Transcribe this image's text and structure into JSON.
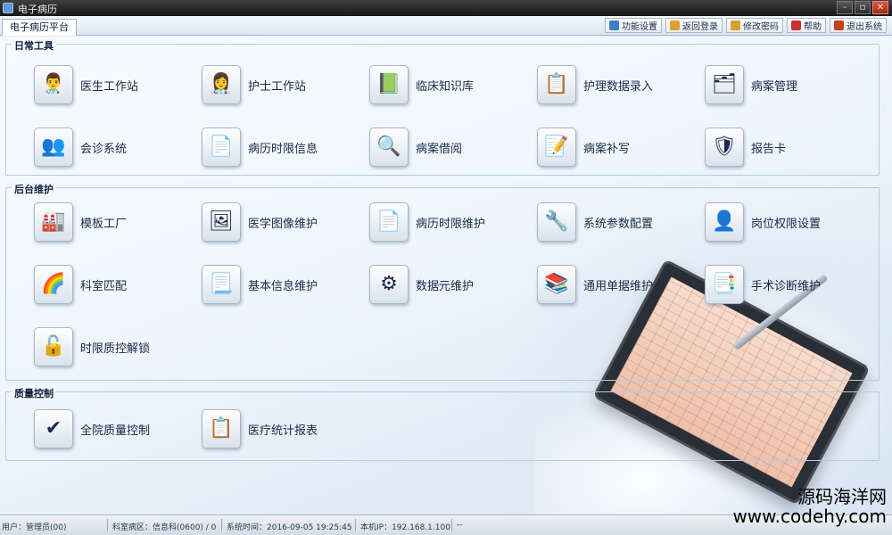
{
  "window": {
    "title": "电子病历",
    "buttons": [
      "-",
      "▫",
      "✕"
    ]
  },
  "tabs": [
    {
      "label": "电子病历平台"
    }
  ],
  "toolbar": [
    {
      "label": "功能设置",
      "icon": "settings-icon",
      "color": "#3d7cc9"
    },
    {
      "label": "返回登录",
      "icon": "home-icon",
      "color": "#e0a030"
    },
    {
      "label": "修改密码",
      "icon": "lock-icon",
      "color": "#d8a02a"
    },
    {
      "label": "帮助",
      "icon": "help-icon",
      "color": "#c93030"
    },
    {
      "label": "退出系统",
      "icon": "exit-icon",
      "color": "#c84020"
    }
  ],
  "sections": {
    "daily": {
      "title": "日常工具",
      "items": [
        {
          "label": "医生工作站",
          "icon": "doctor-icon",
          "glyph": "👨‍⚕️"
        },
        {
          "label": "护士工作站",
          "icon": "nurse-icon",
          "glyph": "👩‍⚕️"
        },
        {
          "label": "临床知识库",
          "icon": "knowledge-base-icon",
          "glyph": "📗"
        },
        {
          "label": "护理数据录入",
          "icon": "nursing-data-icon",
          "glyph": "📋"
        },
        {
          "label": "病案管理",
          "icon": "case-management-icon",
          "glyph": "🗂"
        },
        {
          "label": "会诊系统",
          "icon": "consultation-icon",
          "glyph": "👥"
        },
        {
          "label": "病历时限信息",
          "icon": "record-time-info-icon",
          "glyph": "📄"
        },
        {
          "label": "病案借阅",
          "icon": "case-borrow-icon",
          "glyph": "🔍"
        },
        {
          "label": "病案补写",
          "icon": "case-supplement-icon",
          "glyph": "📝"
        },
        {
          "label": "报告卡",
          "icon": "report-card-icon",
          "glyph": "🛡"
        }
      ]
    },
    "backend": {
      "title": "后台维护",
      "items": [
        {
          "label": "模板工厂",
          "icon": "template-factory-icon",
          "glyph": "🏭"
        },
        {
          "label": "医学图像维护",
          "icon": "medical-image-icon",
          "glyph": "🖼"
        },
        {
          "label": "病历时限维护",
          "icon": "record-time-maintain-icon",
          "glyph": "📄"
        },
        {
          "label": "系统参数配置",
          "icon": "system-params-icon",
          "glyph": "🔧"
        },
        {
          "label": "岗位权限设置",
          "icon": "role-permission-icon",
          "glyph": "👤"
        },
        {
          "label": "科室匹配",
          "icon": "department-match-icon",
          "glyph": "🌈"
        },
        {
          "label": "基本信息维护",
          "icon": "basic-info-icon",
          "glyph": "📃"
        },
        {
          "label": "数据元维护",
          "icon": "data-element-icon",
          "glyph": "⚙"
        },
        {
          "label": "通用单据维护",
          "icon": "common-form-icon",
          "glyph": "📚"
        },
        {
          "label": "手术诊断维护",
          "icon": "surgery-diagnosis-icon",
          "glyph": "📑"
        },
        {
          "label": "时限质控解锁",
          "icon": "time-qc-unlock-icon",
          "glyph": "🔓"
        }
      ]
    },
    "quality": {
      "title": "质量控制",
      "items": [
        {
          "label": "全院质量控制",
          "icon": "quality-shield-icon",
          "glyph": "✔"
        },
        {
          "label": "医疗统计报表",
          "icon": "statistics-report-icon",
          "glyph": "📋"
        }
      ]
    }
  },
  "statusbar": {
    "user": "用户：管理员(00)",
    "department": "科室病区：信息科(0600) / 0",
    "system_time": "系统时间：2016-09-05 19:25:45",
    "local_ip": "本机IP：192.168.1.100",
    "extra": "--"
  },
  "watermark": {
    "line1": "源码海洋网",
    "line2": "www.codehy.com"
  }
}
